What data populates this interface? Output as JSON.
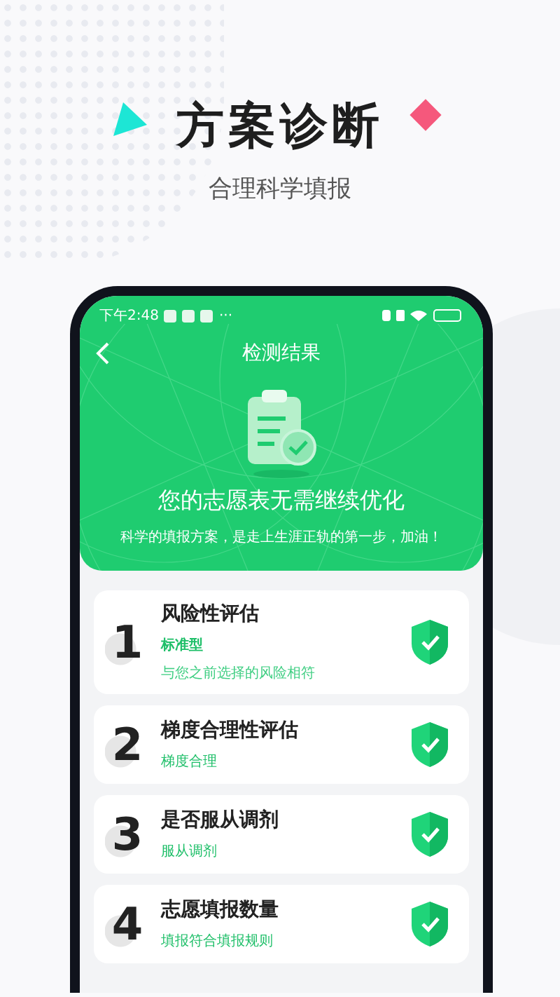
{
  "hero": {
    "title": "方案诊断",
    "subtitle": "合理科学填报"
  },
  "status_bar": {
    "time": "下午2:48",
    "more": "···"
  },
  "header": {
    "title": "检测结果",
    "headline": "您的志愿表无需继续优化",
    "message": "科学的填报方案，是走上生涯正轨的第一步，加油！"
  },
  "checks": [
    {
      "number": "1",
      "title": "风险性评估",
      "result": "标准型",
      "detail": "与您之前选择的风险相符",
      "passed": true
    },
    {
      "number": "2",
      "title": "梯度合理性评估",
      "result": "梯度合理",
      "passed": true
    },
    {
      "number": "3",
      "title": "是否服从调剂",
      "result": "服从调剂",
      "passed": true
    },
    {
      "number": "4",
      "title": "志愿填报数量",
      "result": "填报符合填报规则",
      "passed": true
    }
  ]
}
